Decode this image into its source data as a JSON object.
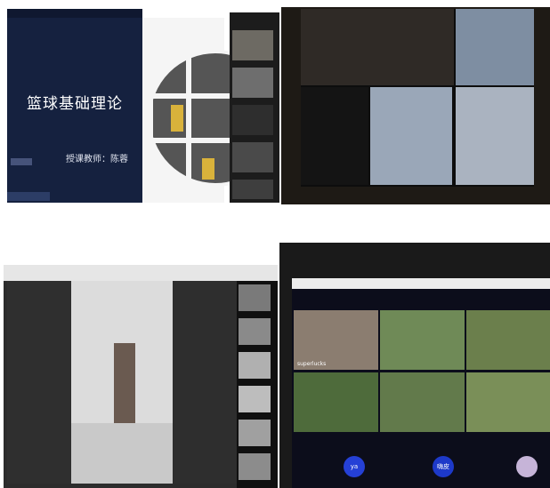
{
  "panel1": {
    "slide_title": "篮球基础理论",
    "teacher": "授课教师：陈蓉",
    "sidebar_captions": [
      "",
      ""
    ]
  },
  "panel2": {
    "cell_captions": [
      "",
      "",
      ""
    ]
  },
  "panel3": {
    "side_captions": [
      "",
      "",
      "",
      "",
      "",
      ""
    ]
  },
  "panel4": {
    "cell_captions": [
      "superlucks",
      "",
      "",
      "",
      "",
      ""
    ],
    "avatars": [
      "ya",
      "嗨皮",
      ""
    ]
  }
}
